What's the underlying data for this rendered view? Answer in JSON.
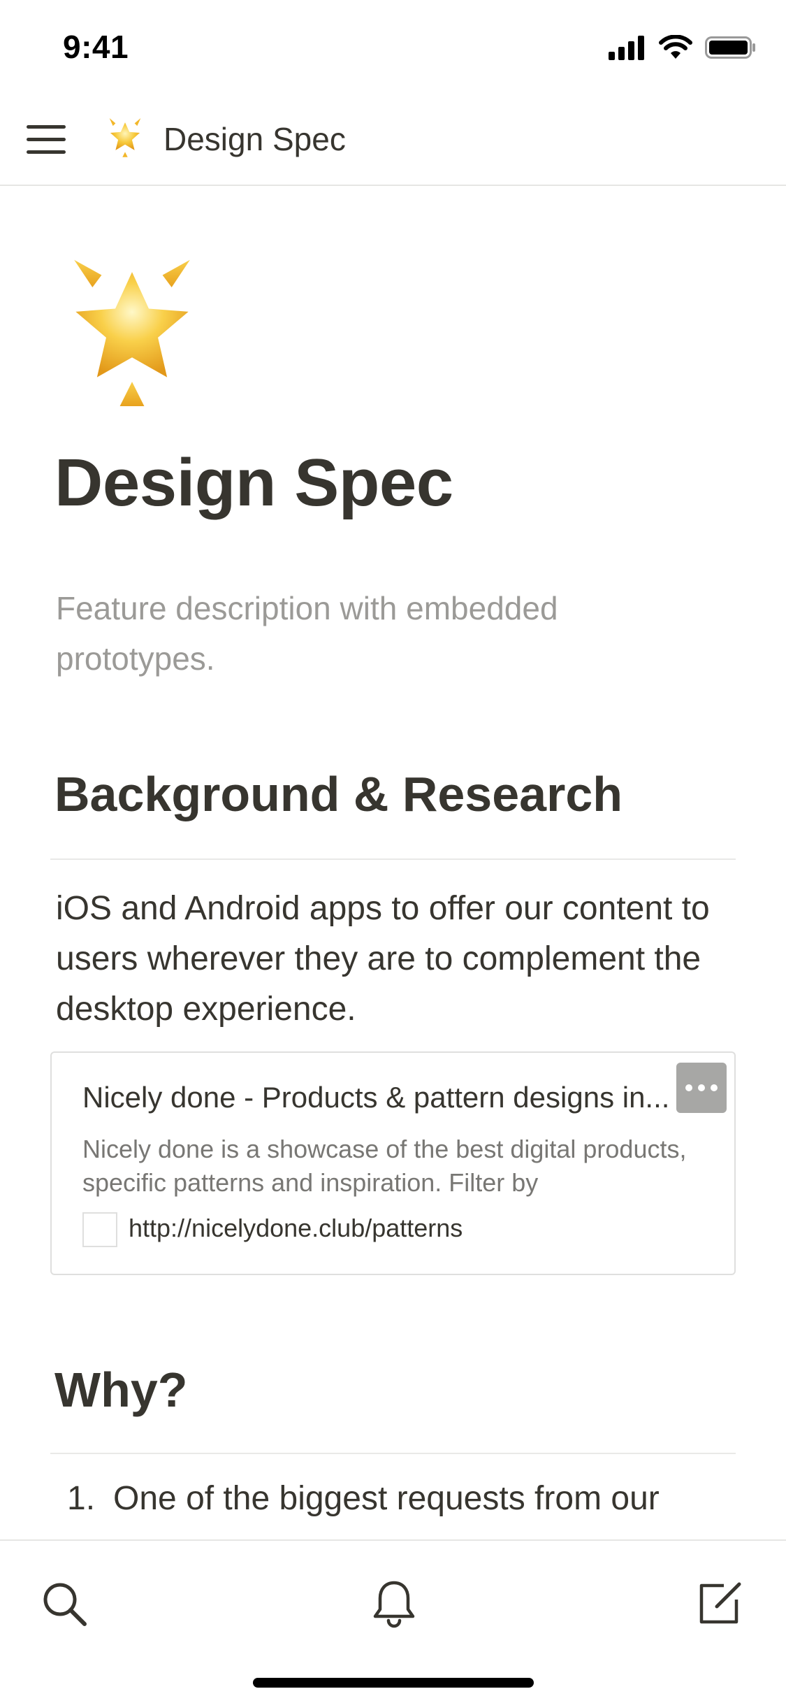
{
  "status_bar": {
    "time": "9:41",
    "icons": [
      "cellular-signal-icon",
      "wifi-icon",
      "battery-icon"
    ]
  },
  "nav": {
    "menu_icon": "hamburger-menu-icon",
    "page_icon": "glowing-star-emoji",
    "title": "Design Spec"
  },
  "page": {
    "icon": "glowing-star-emoji",
    "title": "Design Spec",
    "description": "Feature description with embedded prototypes.",
    "sections": [
      {
        "heading": "Background & Research",
        "paragraph": "iOS and Android apps to offer our content to users wherever they are to complement the desktop experience."
      },
      {
        "heading": "Why?",
        "list": [
          {
            "number": "1.",
            "text": "One of the biggest requests from our"
          }
        ]
      }
    ],
    "bookmark": {
      "title": "Nicely done - Products & pattern designs in...",
      "description": "Nicely done is a showcase of the best digital products, specific patterns and inspiration. Filter by",
      "url": "http://nicelydone.club/patterns",
      "more_icon": "more-options-icon"
    }
  },
  "bottom_bar": {
    "tabs": [
      "search-icon",
      "bell-icon",
      "compose-icon"
    ]
  },
  "colors": {
    "text": "#37352f",
    "muted": "#9b9a97",
    "divider": "#e9e9e7",
    "star_gold": "#f5c02f"
  }
}
